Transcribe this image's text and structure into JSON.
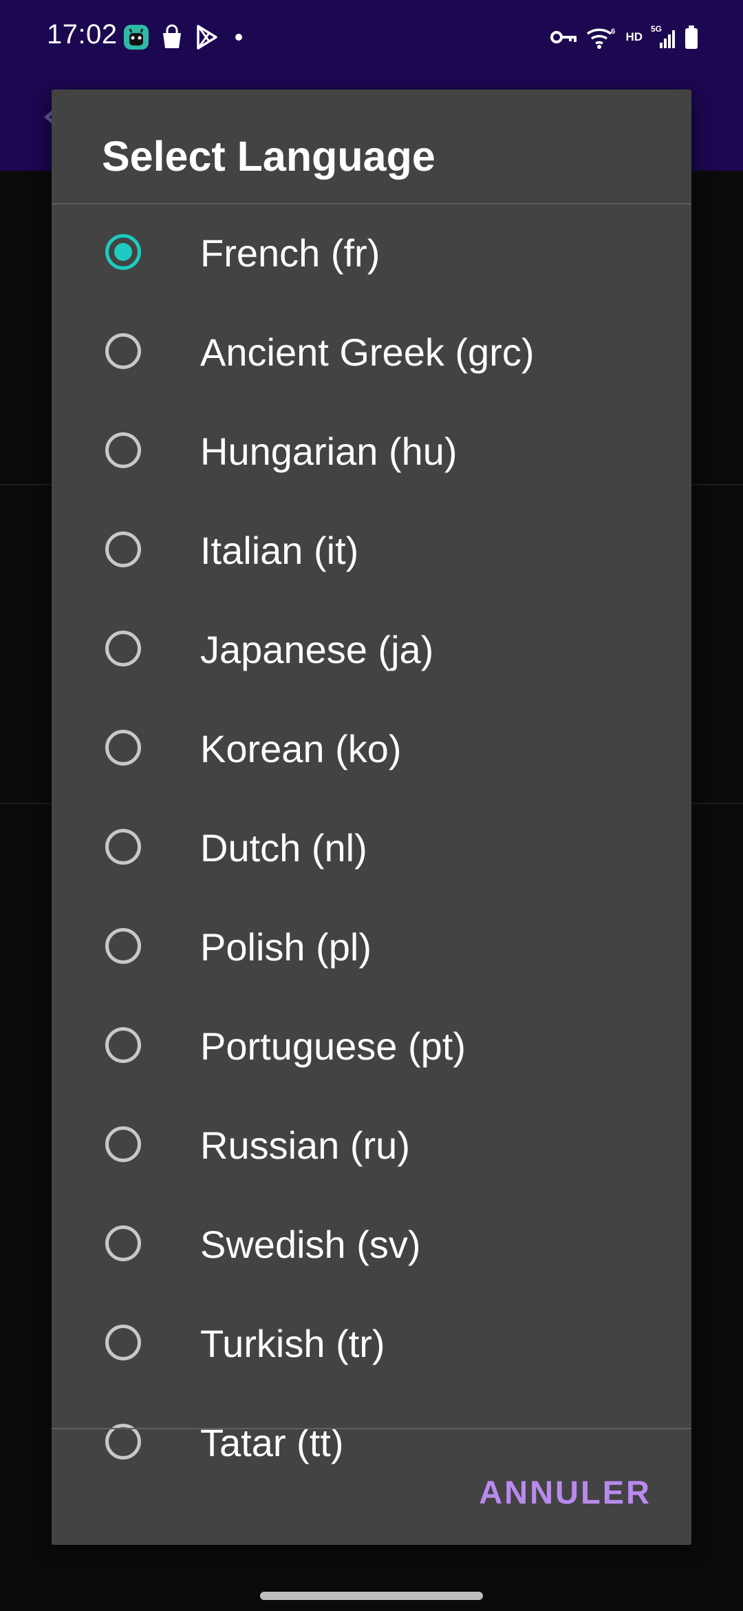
{
  "status_bar": {
    "time": "17:02",
    "left_icons": [
      "android-app-icon",
      "shopping-bag-icon",
      "play-store-icon",
      "notification-dot-icon"
    ],
    "right_icons": [
      "vpn-key-icon",
      "wifi-icon",
      "hd-voice-icon",
      "signal-5g-icon",
      "battery-icon"
    ],
    "hd_label": "HD",
    "network_label": "5G"
  },
  "app_bar": {
    "color": "#1c0751"
  },
  "dialog": {
    "title": "Select Language",
    "selected_index": 0,
    "options": [
      {
        "label": "French (fr)",
        "checked": true
      },
      {
        "label": "Ancient Greek (grc)",
        "checked": false
      },
      {
        "label": "Hungarian (hu)",
        "checked": false
      },
      {
        "label": "Italian (it)",
        "checked": false
      },
      {
        "label": "Japanese (ja)",
        "checked": false
      },
      {
        "label": "Korean (ko)",
        "checked": false
      },
      {
        "label": "Dutch (nl)",
        "checked": false
      },
      {
        "label": "Polish (pl)",
        "checked": false
      },
      {
        "label": "Portuguese (pt)",
        "checked": false
      },
      {
        "label": "Russian (ru)",
        "checked": false
      },
      {
        "label": "Swedish (sv)",
        "checked": false
      },
      {
        "label": "Turkish (tr)",
        "checked": false
      },
      {
        "label": "Tatar (tt)",
        "checked": false
      }
    ],
    "cancel_label": "ANNULER",
    "accent_color": "#1ecbc1",
    "button_color": "#b98aee",
    "background_color": "#434343"
  }
}
